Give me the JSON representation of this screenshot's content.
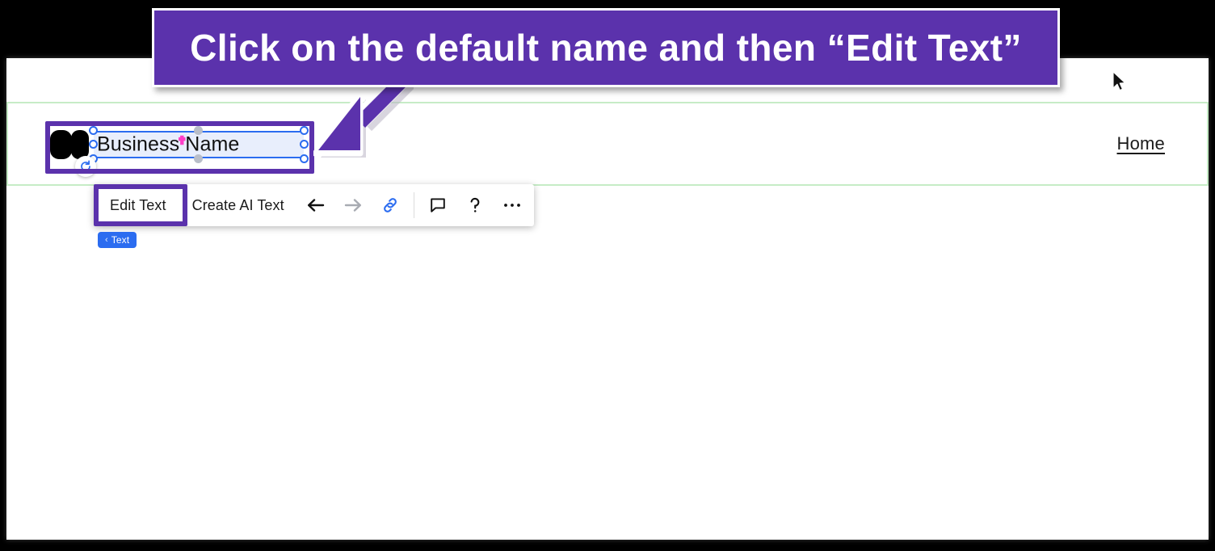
{
  "annotation": {
    "banner_text": "Click on the default name and then “Edit Text”",
    "banner_color": "#5B32AC",
    "arrow_name": "purple-arrow-pointing-to-text-element"
  },
  "site_header": {
    "nav": {
      "home_label": "Home"
    },
    "border_color": "#C6ECC6",
    "logo_name": "business-logo-placeholder"
  },
  "selected_element": {
    "text": "Business Name",
    "type_label": "Text",
    "breadcrumb_chevron": "‹",
    "selection_color": "#2B6CF0",
    "rotate_handle_name": "rotate-handle"
  },
  "toolbar": {
    "edit_text_label": "Edit Text",
    "create_ai_text_label": "Create AI Text",
    "icons": {
      "back": "arrow-left-icon",
      "forward": "arrow-right-icon",
      "link": "link-icon",
      "comment": "comment-icon",
      "help": "question-mark-icon",
      "more": "ellipsis-icon"
    },
    "link_icon_color": "#2B6CF0",
    "forward_disabled_color": "#A8ABB2"
  },
  "cursor": {
    "name": "mouse-pointer"
  }
}
